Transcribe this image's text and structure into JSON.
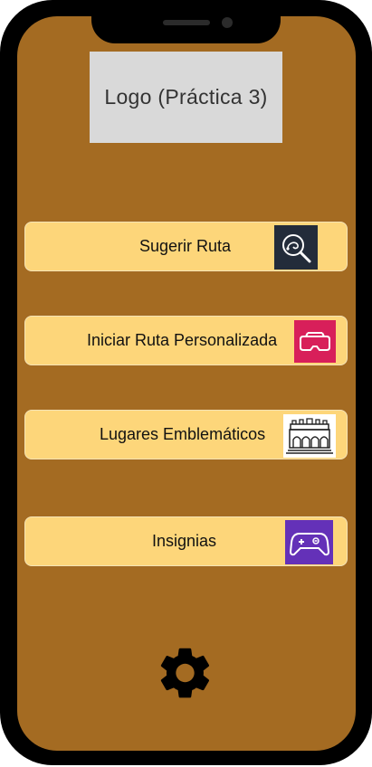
{
  "logo": {
    "text": "Logo (Práctica 3)"
  },
  "menu": {
    "items": [
      {
        "label": "Sugerir Ruta",
        "icon": "route-search-icon"
      },
      {
        "label": "Iniciar Ruta Personalizada",
        "icon": "vr-headset-icon"
      },
      {
        "label": "Lugares Emblemáticos",
        "icon": "monument-icon"
      },
      {
        "label": "Insignias",
        "icon": "gamepad-icon"
      }
    ]
  },
  "footer": {
    "settings_icon": "gear-icon"
  },
  "colors": {
    "screen_background": "#a46b22",
    "button_background": "#fdd67a",
    "logo_placeholder": "#d9d9d9",
    "icon_route_bg": "#232c3a",
    "icon_vr_bg": "#d81f5a",
    "icon_monument_bg": "#ffffff",
    "icon_gamepad_bg": "#6431b8"
  }
}
